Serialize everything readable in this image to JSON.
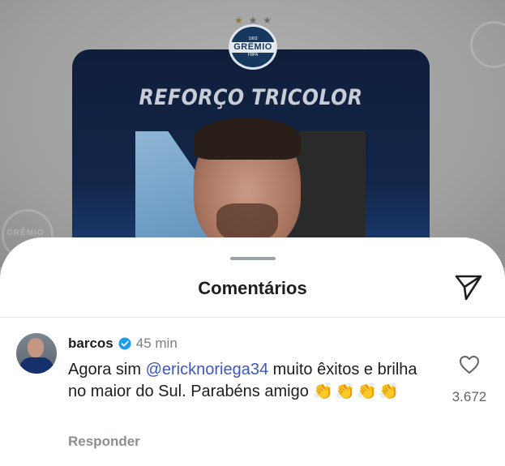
{
  "post": {
    "club_crest": {
      "name": "GRÊMIO",
      "year_top": "1903",
      "year_bottom": "FBPA"
    },
    "card_title": "REFORÇO TRICOLOR",
    "watermark_text": "GRÊMIO"
  },
  "comments_sheet": {
    "title": "Comentários",
    "send_icon": "paper-plane-icon",
    "comments": [
      {
        "username": "barcos",
        "verified": true,
        "time": "45 min",
        "text_before_mention": "Agora sim ",
        "mention": "@ericknoriega34",
        "text_after_mention": " muito êxitos e brilha no maior do Sul. Parabéns amigo ",
        "emoji": "👏👏👏👏",
        "reply_label": "Responder",
        "like_count": "3.672"
      }
    ]
  },
  "colors": {
    "mention": "#3d56c4",
    "verified_badge": "#1d9bf0",
    "card_bg": "#13264a"
  }
}
